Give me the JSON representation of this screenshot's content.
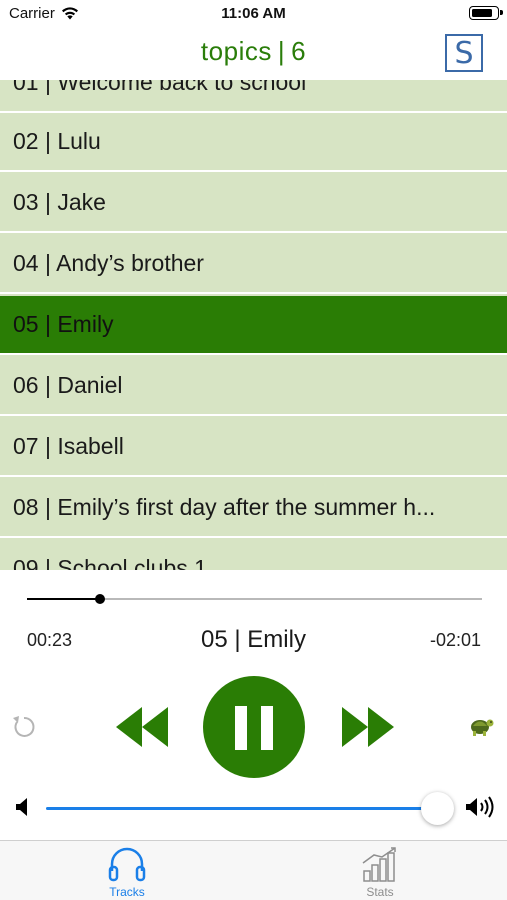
{
  "status_bar": {
    "carrier": "Carrier",
    "time": "11:06 AM",
    "battery_level": 0.85
  },
  "nav": {
    "title_left": "topics",
    "title_separator": "|",
    "title_right": "6",
    "logo_letter": "S"
  },
  "tracks": [
    {
      "label": "01 | Welcome back to school"
    },
    {
      "label": "02 | Lulu"
    },
    {
      "label": "03 | Jake"
    },
    {
      "label": "04 | Andy’s brother"
    },
    {
      "label": "05 | Emily"
    },
    {
      "label": "06 | Daniel"
    },
    {
      "label": "07 | Isabell"
    },
    {
      "label": "08 | Emily’s first day after the summer h..."
    },
    {
      "label": "09 | School clubs 1"
    }
  ],
  "active_track_index": 4,
  "player": {
    "elapsed": "00:23",
    "remaining": "-02:01",
    "now_playing": "05 | Emily",
    "progress_fraction": 0.16,
    "volume_fraction": 0.96
  },
  "tab_bar": {
    "tracks_label": "Tracks",
    "stats_label": "Stats",
    "selected": "Tracks"
  },
  "colors": {
    "brand_green": "#2a7d05",
    "list_bg": "#d7e4c4",
    "accent_blue": "#1a7fe8",
    "logo_blue": "#3b6aa8"
  },
  "icons": {
    "signal": "wifi-icon",
    "repeat": "repeat-icon",
    "rewind": "rewind-icon",
    "pause": "pause-icon",
    "fast_forward": "fast-forward-icon",
    "slow_speed": "turtle-icon",
    "volume_low": "volume-low-icon",
    "volume_high": "volume-high-icon",
    "tracks_tab": "headphones-icon",
    "stats_tab": "stats-chart-icon"
  }
}
